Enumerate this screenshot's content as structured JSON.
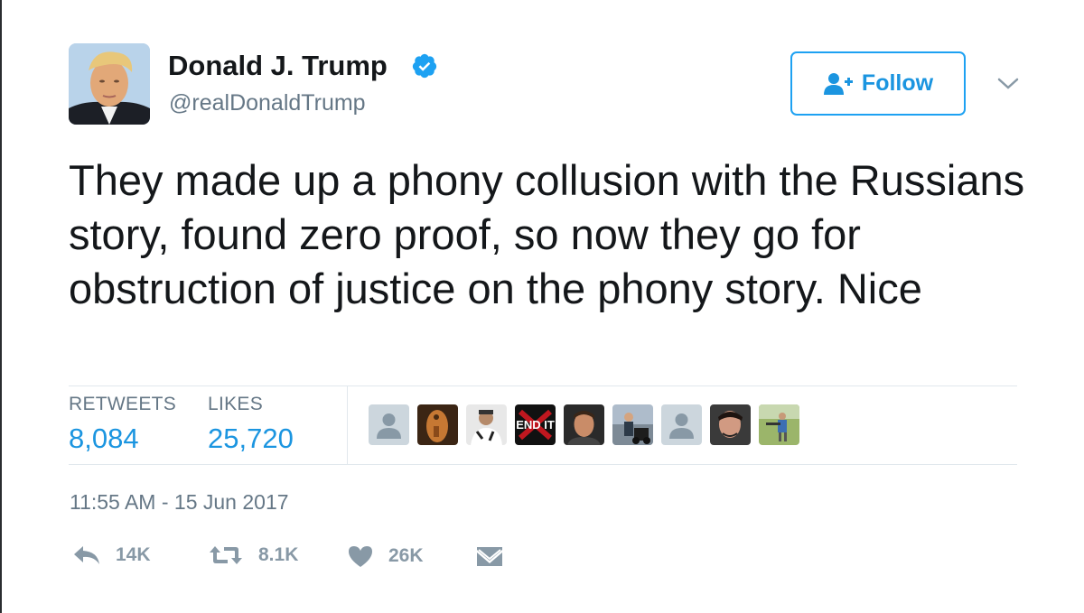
{
  "author": {
    "name": "Donald J. Trump",
    "handle": "@realDonaldTrump",
    "verified": true
  },
  "follow_button": {
    "label": "Follow",
    "icon": "add-user-icon"
  },
  "tweet": {
    "text": "They made up a phony collusion with the Russians story, found zero proof, so now they go for obstruction of justice on the phony story. Nice",
    "timestamp": "11:55 AM - 15 Jun 2017"
  },
  "stats": {
    "retweets_label": "RETWEETS",
    "retweets_value": "8,084",
    "likes_label": "LIKES",
    "likes_value": "25,720"
  },
  "actions": {
    "reply_count": "14K",
    "retweet_count": "8.1K",
    "like_count": "26K"
  },
  "likers": [
    {
      "kind": "default-avatar"
    },
    {
      "kind": "photo"
    },
    {
      "kind": "photo"
    },
    {
      "kind": "logo",
      "text": "END IT"
    },
    {
      "kind": "photo"
    },
    {
      "kind": "photo"
    },
    {
      "kind": "default-avatar"
    },
    {
      "kind": "photo"
    },
    {
      "kind": "photo"
    }
  ],
  "colors": {
    "accent": "#1da1f2",
    "link": "#1b95e0",
    "muted": "#657786",
    "icon": "#8899a6",
    "divider": "#e1e8ed"
  }
}
